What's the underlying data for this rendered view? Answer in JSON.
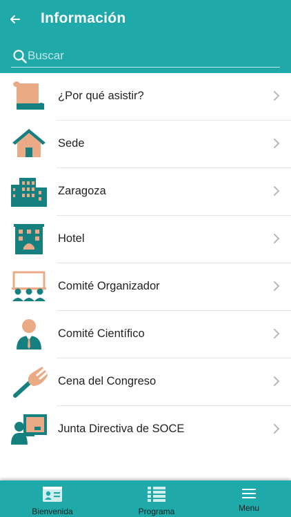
{
  "header": {
    "title": "Información",
    "back_icon": "arrow-left-icon"
  },
  "search": {
    "placeholder": "Buscar",
    "value": ""
  },
  "colors": {
    "primary": "#1fa9a8",
    "icon_teal": "#167f80",
    "icon_peach": "#e9aa85"
  },
  "items": [
    {
      "label": "¿Por qué asistir?",
      "icon": "scroll-icon"
    },
    {
      "label": "Sede",
      "icon": "house-icon"
    },
    {
      "label": "Zaragoza",
      "icon": "city-icon"
    },
    {
      "label": "Hotel",
      "icon": "hotel-icon"
    },
    {
      "label": "Comité Organizador",
      "icon": "committee-icon"
    },
    {
      "label": "Comité Científico",
      "icon": "scientist-icon"
    },
    {
      "label": "Cena del Congreso",
      "icon": "fork-icon"
    },
    {
      "label": "Junta Directiva de SOCE",
      "icon": "board-presenter-icon"
    }
  ],
  "bottom_nav": [
    {
      "label": "Bienvenida",
      "icon": "id-card-icon"
    },
    {
      "label": "Programa",
      "icon": "list-icon"
    },
    {
      "label": "Menu",
      "icon": "hamburger-icon"
    }
  ]
}
